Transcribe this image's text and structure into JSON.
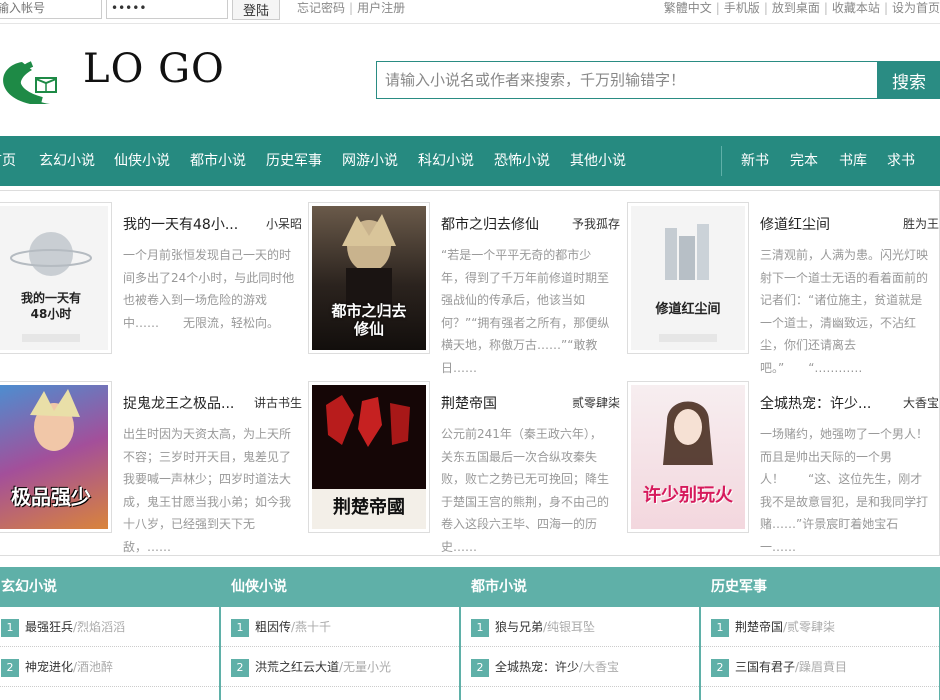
{
  "topbar": {
    "username_placeholder": "输入帐号",
    "password_value": "•••••",
    "login_label": "登陆",
    "left_links": [
      "忘记密码",
      "用户注册"
    ],
    "right_links": [
      "繁體中文",
      "手机版",
      "放到桌面",
      "收藏本站",
      "设为首页"
    ]
  },
  "header": {
    "logo_text": "LO GO",
    "search_placeholder": "请输入小说名或作者来搜索，千万别输错字！",
    "search_button": "搜索"
  },
  "nav": {
    "items": [
      "首页",
      "玄幻小说",
      "仙侠小说",
      "都市小说",
      "历史军事",
      "网游小说",
      "科幻小说",
      "恐怖小说",
      "其他小说"
    ],
    "right_items": [
      "新书",
      "完本",
      "书库",
      "求书"
    ]
  },
  "featured": [
    {
      "title": "我的一天有48小...",
      "author": "小呆昭",
      "desc": "一个月前张恒发现自己一天的时间多出了24个小时，与此同时他也被卷入到一场危险的游戏中……　　无限流，轻松向。",
      "cover_title": "我的一天有48小时",
      "cover_style": "light"
    },
    {
      "title": "都市之归去修仙",
      "author": "予我孤存",
      "desc": "“若是一个平平无奇的都市少年，得到了千万年前修道时期至强战仙的传承后，他该当如何？”“拥有强者之所有，那便纵横天地，称傲万古……”“敢教日……",
      "cover_title": "都市之归去修仙",
      "cover_style": "dark"
    },
    {
      "title": "修道红尘间",
      "author": "胜为王",
      "desc": "三清观前，人满为患。闪光灯映射下一个道士无语的看着面前的记者们：“诸位施主，贫道就是一个道士，清幽致远，不沾红尘，你们还请离去吧。”　　“…………",
      "cover_title": "修道红尘间",
      "cover_style": "light"
    },
    {
      "title": "捉鬼龙王之极品...",
      "author": "讲古书生",
      "desc": "出生时因为天资太高，为上天所不容；三岁时开天目，鬼差见了我要喊一声林少；四岁时道法大成，鬼王甘愿当我小弟；如今我十八岁，已经强到天下无敌，……",
      "cover_title": "极品强少",
      "cover_style": "anime"
    },
    {
      "title": "荆楚帝国",
      "author": "贰零肆柒",
      "desc": "公元前241年（秦王政六年），关东五国最后一次合纵攻秦失败，败亡之势已无可挽回；降生于楚国王宫的熊荆，身不由己的卷入这段六王毕、四海一的历史……",
      "cover_title": "荆楚帝國",
      "cover_style": "seal"
    },
    {
      "title": "全城热宠：许少...",
      "author": "大香宝",
      "desc": "一场赌约，她强吻了一个男人！而且是帅出天际的一个男人！　　“这、这位先生，刚才我不是故意冒犯，是和我同学打赌……”许景宸盯着她宝石一……",
      "cover_title": "许少别玩火",
      "cover_style": "pink"
    }
  ],
  "categories": [
    {
      "name": "玄幻小说",
      "items": [
        {
          "rank": "1",
          "title": "最强狂兵",
          "author": "/烈焰滔滔"
        },
        {
          "rank": "2",
          "title": "神宠进化",
          "author": "/酒池醉"
        }
      ]
    },
    {
      "name": "仙侠小说",
      "items": [
        {
          "rank": "1",
          "title": "粗因传",
          "author": "/燕十千"
        },
        {
          "rank": "2",
          "title": "洪荒之红云大道",
          "author": "/无量小光"
        }
      ]
    },
    {
      "name": "都市小说",
      "items": [
        {
          "rank": "1",
          "title": "狼与兄弟",
          "author": "/纯银耳坠"
        },
        {
          "rank": "2",
          "title": "全城热宠：许少",
          "author": "/大香宝"
        }
      ]
    },
    {
      "name": "历史军事",
      "items": [
        {
          "rank": "1",
          "title": "荆楚帝国",
          "author": "/贰零肆柒"
        },
        {
          "rank": "2",
          "title": "三国有君子",
          "author": "/躁眉賁目"
        }
      ]
    }
  ],
  "colors": {
    "accent": "#268a80",
    "accent_light": "#5fb0a8"
  }
}
